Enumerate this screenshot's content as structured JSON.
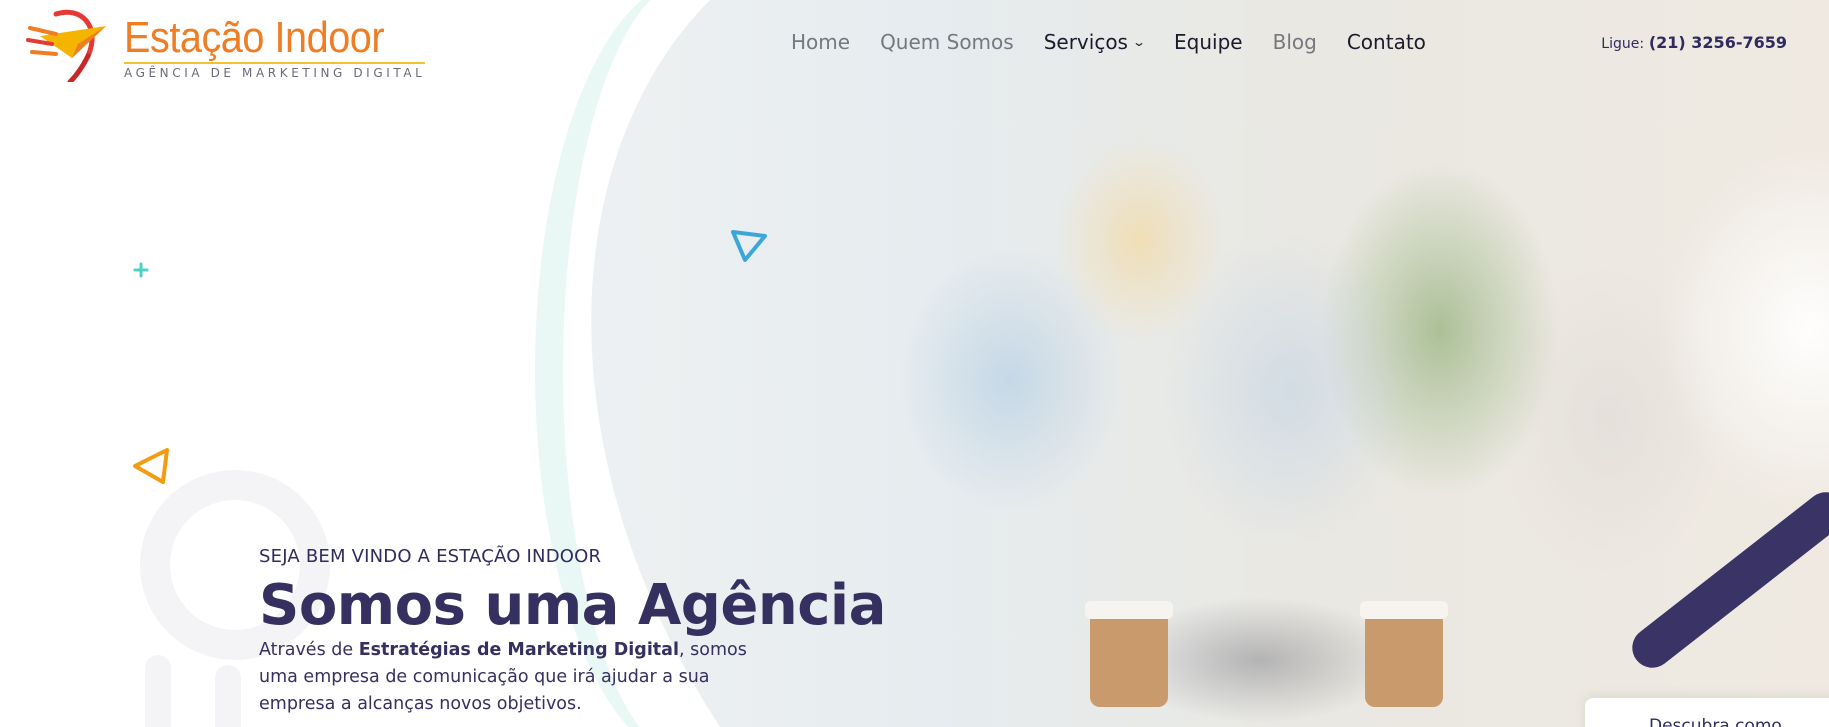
{
  "brand": {
    "name": "Estação Indoor",
    "tagline": "AGÊNCIA DE MARKETING DIGITAL",
    "primary_color": "#ef7d23",
    "accent_color": "#f2c230",
    "logo_icon": "paper-plane-logo-icon"
  },
  "nav": {
    "items": [
      {
        "label": "Home"
      },
      {
        "label": "Quem Somos"
      },
      {
        "label": "Serviços"
      },
      {
        "label": "Equipe"
      },
      {
        "label": "Blog"
      },
      {
        "label": "Contato"
      }
    ]
  },
  "contact": {
    "label": "Ligue:",
    "phone": "(21) 3256-7659"
  },
  "hero": {
    "eyebrow": "SEJA BEM VINDO A ESTAÇÃO INDOOR",
    "headline": "Somos uma Agência",
    "desc_prefix": "Através de ",
    "desc_bold": "Estratégias de Marketing Digital",
    "desc_suffix": ", somos uma empresa de comunicação que irá ajudar a sua empresa a alcanças novos objetivos.",
    "text_color": "#35305f"
  },
  "discover_card": {
    "label": "Descubra como"
  },
  "decorations": {
    "plus_color": "#4fd1c5",
    "triangle_blue_color": "#3ba7d8",
    "triangle_orange_color": "#f39c12"
  }
}
